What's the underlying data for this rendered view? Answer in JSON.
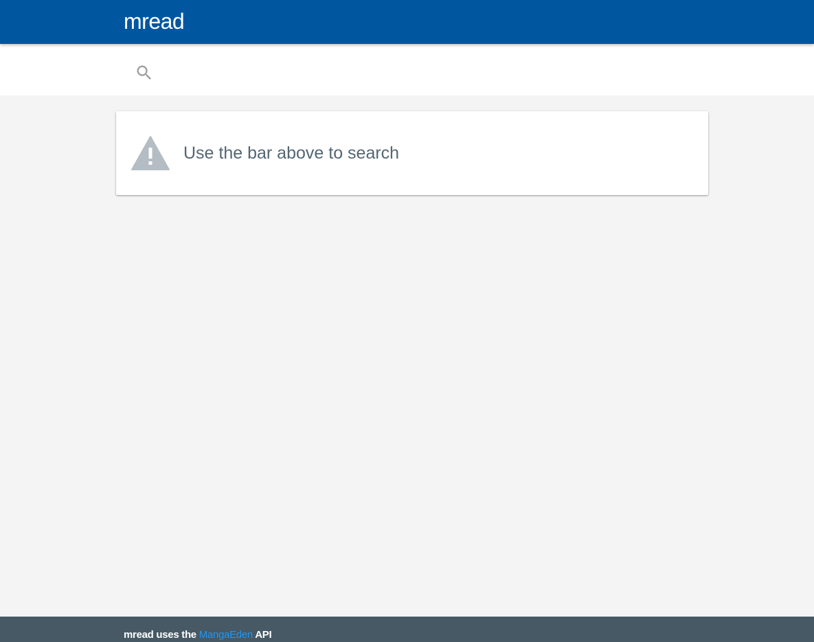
{
  "header": {
    "title": "mread",
    "background_color": "#0057a0"
  },
  "search": {
    "icon": "search-icon",
    "placeholder": "",
    "value": ""
  },
  "notice": {
    "icon": "warning-icon",
    "message": "Use the bar above to search"
  },
  "footer": {
    "prefix": "mread uses the",
    "link_text": "MangaEden",
    "suffix": "API",
    "link_color": "#2196f3",
    "background_color": "#465965"
  }
}
